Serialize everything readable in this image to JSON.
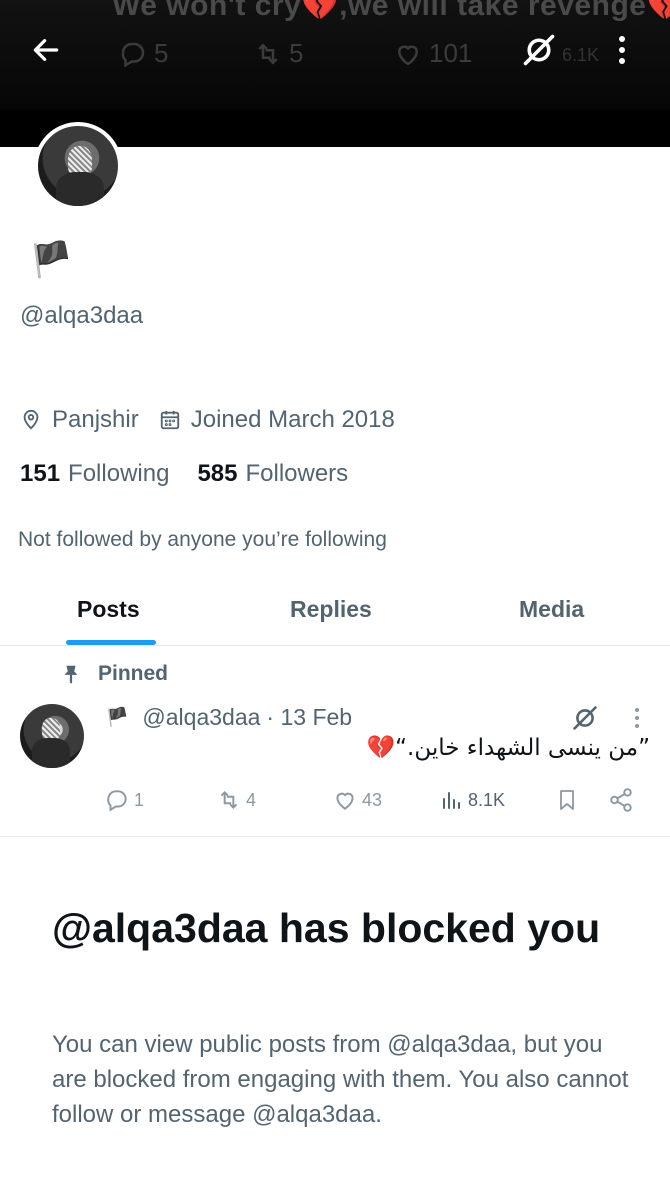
{
  "banner": {
    "ghost_text": "We won't cry",
    "ghost_heart": "💔",
    "ghost_text_2": ",we will take revenge",
    "ghost_heart_2": "💔",
    "stats": {
      "replies": "5",
      "reposts": "5",
      "likes": "101",
      "views": "6.1K"
    },
    "icons": {
      "back": "arrow-left-icon",
      "grok": "grok-icon",
      "more": "more-vertical-icon"
    }
  },
  "profile": {
    "flag": "🏴",
    "handle": "@alqa3daa",
    "location": "Panjshir",
    "joined": "Joined March 2018",
    "following_count": "151",
    "following_label": "Following",
    "followers_count": "585",
    "followers_label": "Followers",
    "not_followed": "Not followed by anyone you’re following"
  },
  "tabs": [
    {
      "label": "Posts",
      "active": true
    },
    {
      "label": "Replies",
      "active": false
    },
    {
      "label": "Media",
      "active": false
    }
  ],
  "pinned_post": {
    "pinned_label": "Pinned",
    "flag": "🏴",
    "author": "@alqa3daa",
    "date": "· 13 Feb",
    "text": "”من ينسى الشهداء خاين.“",
    "heart": "💔",
    "replies": "1",
    "reposts": "4",
    "likes": "43",
    "views": "8.1K"
  },
  "blocked": {
    "title": "@alqa3daa has blocked you",
    "body": "You can view public posts from @alqa3daa, but you are blocked from engaging with them. You also cannot follow or message @alqa3daa."
  },
  "colors": {
    "accent": "#1d9bf0",
    "text": "#0f1419",
    "secondary": "#536471",
    "banner": "#000000"
  }
}
